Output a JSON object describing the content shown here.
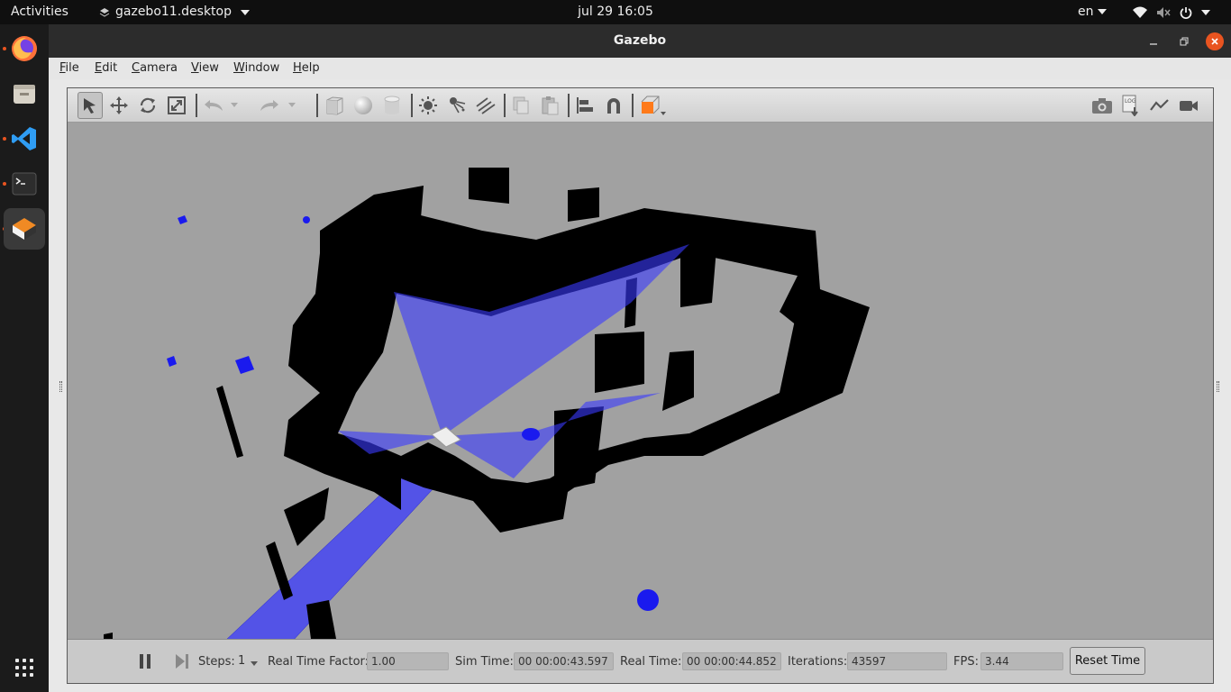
{
  "topbar": {
    "activities": "Activities",
    "app_menu": "gazebo11.desktop",
    "clock": "jul 29  16:05",
    "lang": "en"
  },
  "dock": {
    "items": [
      "firefox-icon",
      "files-icon",
      "vscode-icon",
      "terminal-icon",
      "gazebo-icon"
    ],
    "active": "gazebo-icon"
  },
  "window": {
    "title": "Gazebo"
  },
  "menubar": {
    "items": [
      {
        "label": "File",
        "mnemonic": "F",
        "rest": "ile"
      },
      {
        "label": "Edit",
        "mnemonic": "E",
        "rest": "dit"
      },
      {
        "label": "Camera",
        "mnemonic": "C",
        "rest": "amera"
      },
      {
        "label": "View",
        "mnemonic": "V",
        "rest": "iew"
      },
      {
        "label": "Window",
        "mnemonic": "W",
        "rest": "indow"
      },
      {
        "label": "Help",
        "mnemonic": "H",
        "rest": "elp"
      }
    ]
  },
  "toolbar": {
    "tools": [
      "select-mode",
      "translate-mode",
      "rotate-mode",
      "scale-mode",
      "undo",
      "redo",
      "box-shape",
      "sphere-shape",
      "cylinder-shape",
      "point-light",
      "spot-light",
      "directional-light",
      "copy",
      "paste",
      "align",
      "snap",
      "change-view",
      "screenshot",
      "log",
      "plot",
      "video-record"
    ],
    "active_tool": "select-mode"
  },
  "bottombar": {
    "steps_label": "Steps:",
    "steps_value": "1",
    "rtf_label": "Real Time Factor:",
    "rtf_value": "1.00",
    "sim_time_label": "Sim Time:",
    "sim_time_value": "00 00:00:43.597",
    "real_time_label": "Real Time:",
    "real_time_value": "00 00:00:44.852",
    "iterations_label": "Iterations:",
    "iterations_value": "43597",
    "fps_label": "FPS:",
    "fps_value": "3.44",
    "reset_label": "Reset Time"
  },
  "colors": {
    "laser": "#3333ff",
    "walls": "#000000",
    "ground": "#a1a1a1",
    "accent": "#e95420"
  }
}
